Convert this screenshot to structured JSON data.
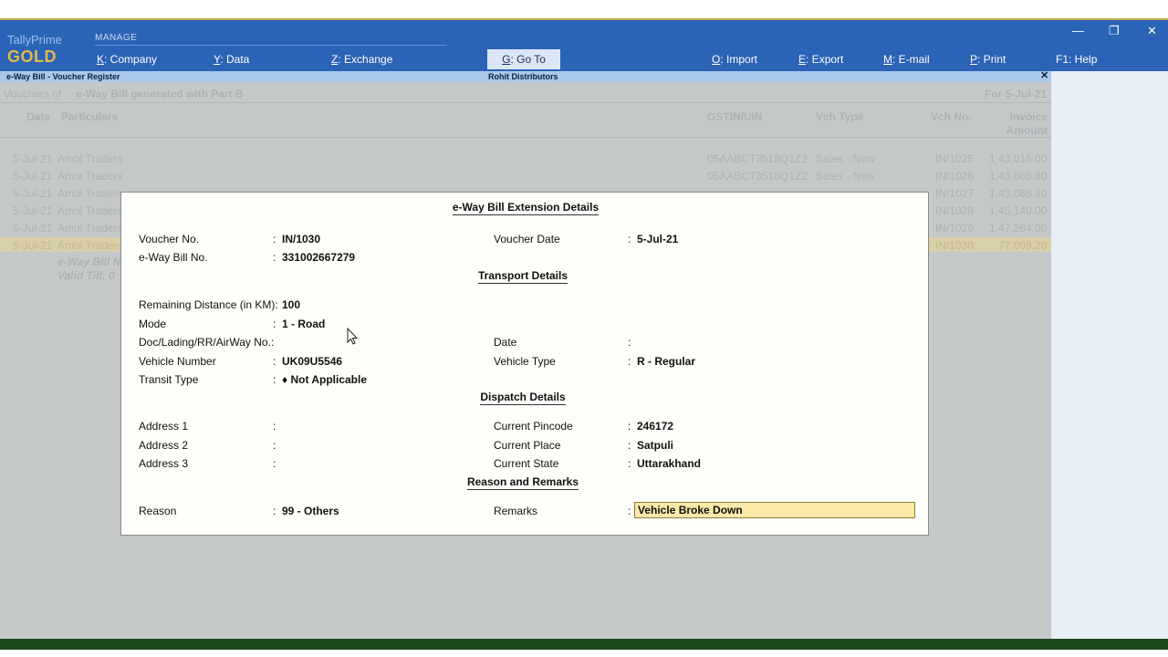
{
  "app": {
    "brand_top": "TallyPrime",
    "brand_gold": "GOLD",
    "section": "MANAGE"
  },
  "menu": [
    {
      "key": "K",
      "label": ": Company"
    },
    {
      "key": "Y",
      "label": ": Data"
    },
    {
      "key": "Z",
      "label": ": Exchange"
    },
    {
      "key": "G",
      "label": ": Go To"
    },
    {
      "key": "O",
      "label": ": Import"
    },
    {
      "key": "E",
      "label": ": Export"
    },
    {
      "key": "M",
      "label": ": E-mail"
    },
    {
      "key": "P",
      "label": ": Print"
    },
    {
      "key": "F1",
      "label": ": Help"
    }
  ],
  "subheader": {
    "left": "e-Way Bill  -  Voucher Register",
    "center": "Rohit Distributors",
    "close": "✕"
  },
  "register": {
    "vouchers_of_label": "Vouchers of",
    "vouchers_of_value": "e-Way Bill generated with Part B",
    "period": "For 5-Jul-21",
    "columns": [
      "Date",
      "Particulars",
      "GSTIN/UIN",
      "Vch Type",
      "Vch No.",
      "Invoice Amount"
    ],
    "rows": [
      {
        "date": "5-Jul-21",
        "party": "Amol Traders",
        "gstin": "05AABCT3518Q1Z2",
        "type": "Sales - New",
        "no": "IN/1025",
        "amount": "1,43,016.00"
      },
      {
        "date": "5-Jul-21",
        "party": "Amol Traders",
        "gstin": "05AABCT3518Q1Z2",
        "type": "Sales - New",
        "no": "IN/1026",
        "amount": "1,43,086.80"
      },
      {
        "date": "5-Jul-21",
        "party": "Amol Traders",
        "gstin": "",
        "type": "",
        "no": "IN/1027",
        "amount": "1,43,086.80"
      },
      {
        "date": "5-Jul-21",
        "party": "Amol Traders",
        "gstin": "",
        "type": "",
        "no": "IN/1028",
        "amount": "1,45,140.00"
      },
      {
        "date": "5-Jul-21",
        "party": "Amol Traders",
        "gstin": "",
        "type": "",
        "no": "IN/1029",
        "amount": "1,47,264.00"
      },
      {
        "date": "5-Jul-21",
        "party": "Amol Traders",
        "gstin": "",
        "type": "",
        "no": "IN/1030",
        "amount": "77,009.20"
      }
    ],
    "sub_line_1": "e-Way Bill N",
    "sub_line_2": "Valid Till: 0"
  },
  "dialog": {
    "title": "e-Way Bill Extension Details",
    "voucher_no_label": "Voucher No.",
    "voucher_no": "IN/1030",
    "voucher_date_label": "Voucher Date",
    "voucher_date": "5-Jul-21",
    "ewb_no_label": "e-Way Bill No.",
    "ewb_no": "331002667279",
    "transport_title": "Transport Details",
    "remaining_distance_label": "Remaining Distance (in KM):",
    "remaining_distance": "100",
    "mode_label": "Mode",
    "mode": "1 - Road",
    "doc_label": "Doc/Lading/RR/AirWay No.:",
    "date_label": "Date",
    "vehicle_number_label": "Vehicle Number",
    "vehicle_number": "UK09U5546",
    "vehicle_type_label": "Vehicle Type",
    "vehicle_type": "R - Regular",
    "transit_type_label": "Transit Type",
    "transit_type": "♦ Not Applicable",
    "dispatch_title": "Dispatch Details",
    "address1_label": "Address 1",
    "address2_label": "Address 2",
    "address3_label": "Address 3",
    "pincode_label": "Current Pincode",
    "pincode": "246172",
    "place_label": "Current Place",
    "place": "Satpuli",
    "state_label": "Current State",
    "state": "Uttarakhand",
    "reason_title": "Reason and Remarks",
    "reason_label": "Reason",
    "reason": "99 - Others",
    "remarks_label": "Remarks",
    "remarks": "Vehicle Broke Down"
  },
  "colors": {
    "header_blue": "#2b63b6",
    "brand_gold": "#e2b94a",
    "input_highlight": "#fbe9a8",
    "footer_green": "#1b4a1e"
  }
}
